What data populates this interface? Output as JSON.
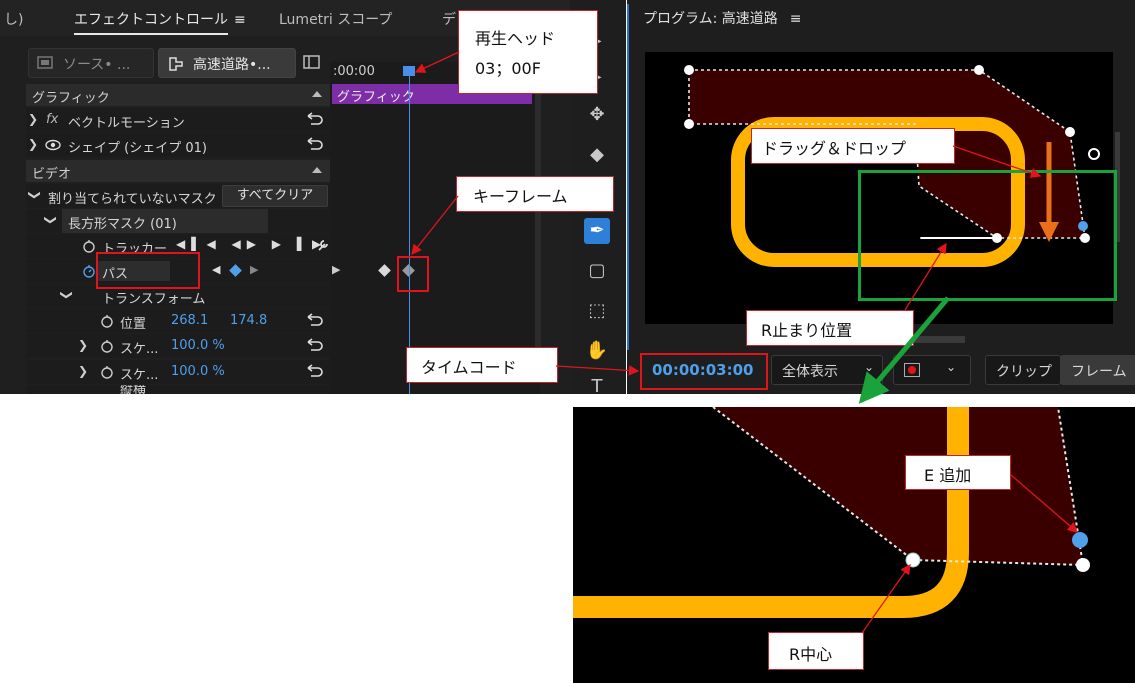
{
  "tabs": {
    "cut_prefix": "し)",
    "effect_controls": "エフェクトコントロール",
    "effect_controls_menu": "≡",
    "lumetri": "Lumetri スコープ",
    "cut_suffix": "デ"
  },
  "source_buttons": {
    "source": "ソース• ...",
    "sequence": "高速道路•..."
  },
  "timeline": {
    "timecode_ruler": ":00:00",
    "clip_label": "グラフィック"
  },
  "sections": {
    "graphic": "グラフィック",
    "video": "ビデオ"
  },
  "rows": {
    "vector_motion_fx": "fx",
    "vector_motion": "ベクトルモーション",
    "shape": "シェイプ (シェイプ 01)",
    "unassigned_mask": "割り当てられていないマスク",
    "clear_all": "すべてクリア",
    "rect_mask": "長方形マスク (01)",
    "tracker": "トラッカー",
    "path": "パス",
    "transform": "トランスフォーム",
    "position": "位置",
    "position_x": "268.1",
    "position_y": "174.8",
    "scale1": "スケ...",
    "scale1_val": "100.0 %",
    "scale2": "スケ...",
    "scale2_val": "100.0 %",
    "cut_row": "縦横"
  },
  "program": {
    "title": "プログラム: 高速道路",
    "menu": "≡",
    "timecode": "00:00:03:00",
    "fit": "全体表示",
    "clip": "クリップ",
    "frame": "フレーム"
  },
  "callouts": {
    "playhead_line1": "再生ヘッド",
    "playhead_line2": "03；00F",
    "keyframe": "キーフレーム",
    "timecode": "タイムコード",
    "drag_drop": "ドラッグ＆ドロップ",
    "r_stop": "R止まり位置",
    "e_add": "E 追加",
    "r_center": "R中心"
  },
  "colors": {
    "accent_blue": "#4a8ee8",
    "clip_purple": "#7d2ea6",
    "callout_red": "#c0262b",
    "road_orange": "#ffb300",
    "shape_fill": "#3a0000",
    "green_frame": "#1aa33a",
    "arrow_orange": "#e8701a"
  }
}
